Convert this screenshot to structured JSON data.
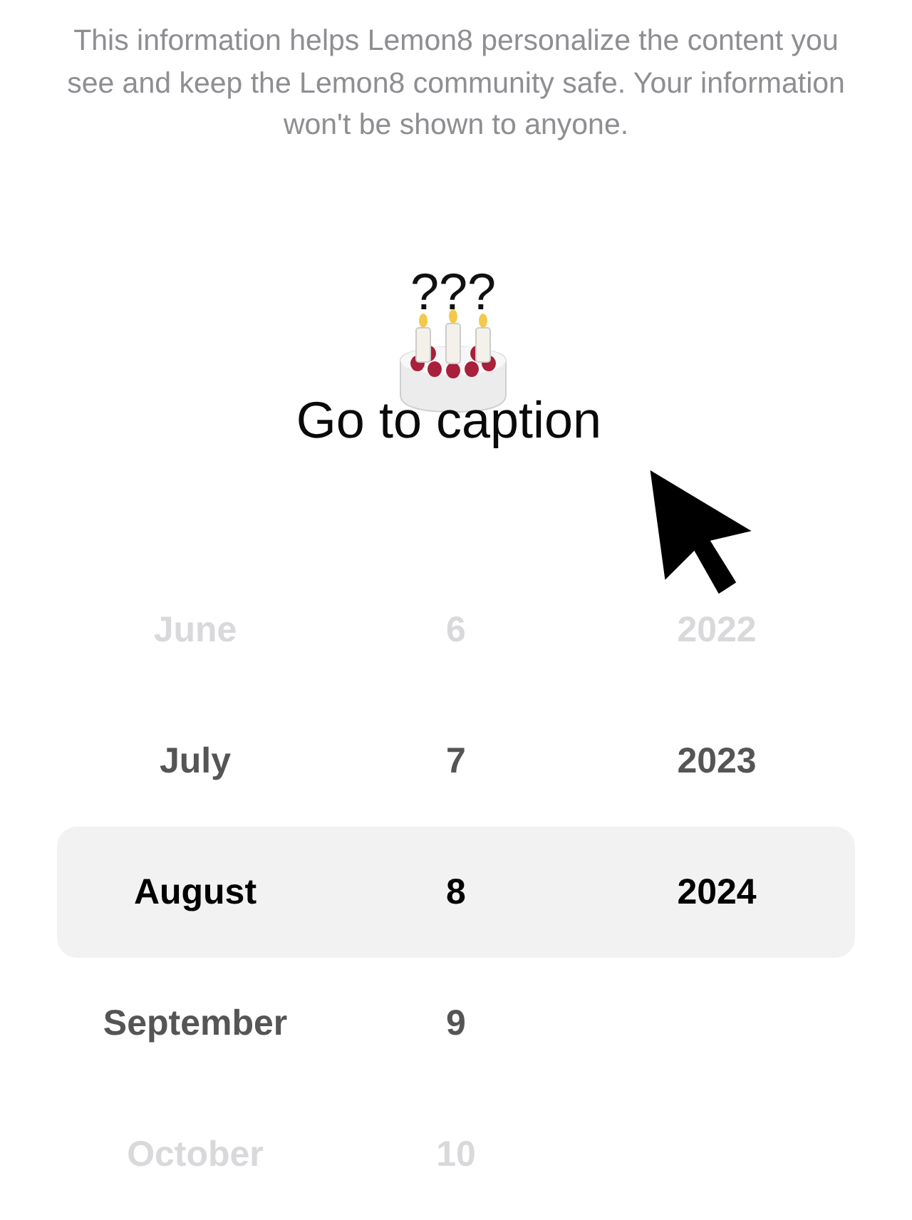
{
  "intro": "This information helps Lemon8 personalize the content you see and keep the Lemon8 community safe. Your information won't be shown to anyone.",
  "overlay": {
    "question": "???",
    "caption": "Go to caption"
  },
  "picker": {
    "rows": [
      {
        "month": "June",
        "day": "6",
        "year": "2022",
        "selected": false
      },
      {
        "month": "July",
        "day": "7",
        "year": "2023",
        "selected": false
      },
      {
        "month": "August",
        "day": "8",
        "year": "2024",
        "selected": true
      },
      {
        "month": "September",
        "day": "9",
        "selected": false
      },
      {
        "month": "October",
        "day": "10",
        "selected": false
      }
    ]
  }
}
